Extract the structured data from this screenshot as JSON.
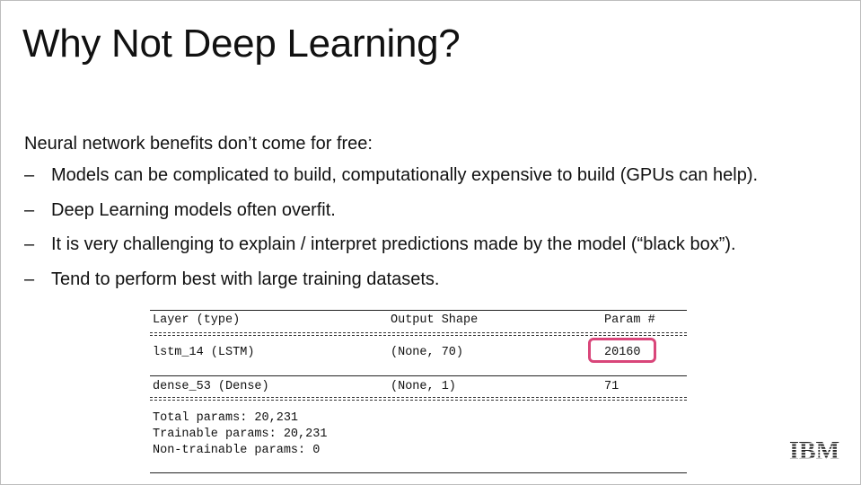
{
  "slide": {
    "title": "Why Not Deep Learning?",
    "intro": "Neural network benefits don’t come for free:",
    "bullet_marker": "–",
    "bullets": [
      "Models can be complicated to build, computationally expensive to build (GPUs can help).",
      "Deep Learning models often overfit.",
      "It is very challenging to explain / interpret predictions made by the model (“black box”).",
      "Tend to perform best with large training datasets."
    ]
  },
  "model_summary": {
    "headers": {
      "layer": "Layer (type)",
      "output": "Output Shape",
      "params": "Param #"
    },
    "rows": [
      {
        "layer": "lstm_14 (LSTM)",
        "output": "(None, 70)",
        "params": "20160"
      },
      {
        "layer": "dense_53 (Dense)",
        "output": "(None, 1)",
        "params": "71"
      }
    ],
    "totals": [
      "Total params: 20,231",
      "Trainable params: 20,231",
      "Non-trainable params: 0"
    ],
    "highlight_color": "#d9467a"
  },
  "logo": {
    "text": "IBM",
    "icon": "ibm-logo-icon"
  }
}
